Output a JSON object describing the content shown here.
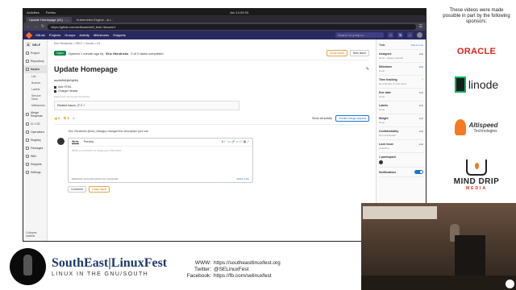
{
  "system_bar": {
    "activities": "Activities",
    "browser": "Firefox",
    "clock": "Jun 14  09:33"
  },
  "browser": {
    "tabs": [
      "Update Homepage (#1) · ...",
      "Kubernetes Engine - sl-i..."
    ],
    "url": "https://gitlab.com/selfsuse/self_test/-/issues/1"
  },
  "gitlab_header": {
    "logo": "GitLab",
    "menus": [
      "Projects",
      "Groups",
      "Activity",
      "Milestones",
      "Snippets"
    ],
    "search_placeholder": "Search or jump to..."
  },
  "left_sidebar": {
    "project_initial": "S",
    "project_name": "SELF",
    "items": [
      "Project",
      "Repository",
      "Issues",
      "Merge Requests",
      "CI / CD",
      "Operations",
      "Registry",
      "Packages",
      "Wiki",
      "Snippets",
      "Settings"
    ],
    "issue_subitems": [
      "List",
      "Boards",
      "Labels",
      "Service Desk",
      "Milestones"
    ],
    "collapse": "Collapse sidebar"
  },
  "issue": {
    "breadcrumb": "Eric Hendricks > SELF > Issues > #1",
    "status": "Open",
    "opened_by": "Opened 1 minute ago by",
    "author": "Eric Hendricks",
    "tasks_summary": "0 of 2 tasks completed",
    "close_button": "Close issue",
    "new_button": "New issue",
    "title": "Update Homepage",
    "description": "asdfdfhfhjkfhjkfhj",
    "tasks": [
      "Add HTML",
      "Change Header"
    ],
    "edited": "Edited just now by Eric Hendricks",
    "related_label": "Related issues",
    "related_count": "0",
    "thumbs_up": "0",
    "thumbs_down": "0",
    "show_all": "Show all activity",
    "merge_button": "Create merge request",
    "event_text": "Eric Hendricks @eric_thedguy changed the description just now",
    "write_tab": "Write",
    "preview_tab": "Preview",
    "comment_placeholder": "Write a comment or drag your files here…",
    "markdown_note": "Markdown and quick actions are supported",
    "attach": "Attach a file",
    "comment_button": "Comment",
    "close_issue_button": "Close issue"
  },
  "right_sidebar": {
    "todo": "Todo",
    "add_todo": "Add a to do",
    "fields": [
      {
        "label": "Assignee",
        "value": "None - assign yourself"
      },
      {
        "label": "Milestone",
        "value": "None"
      },
      {
        "label": "Time tracking",
        "value": "No estimate or time spent"
      },
      {
        "label": "Due date",
        "value": "None"
      },
      {
        "label": "Labels",
        "value": "None"
      },
      {
        "label": "Weight",
        "value": "None"
      },
      {
        "label": "Confidentiality",
        "value": "Not confidential"
      },
      {
        "label": "Lock issue",
        "value": "Unlocked"
      }
    ],
    "edit": "Edit",
    "participants": "1 participant",
    "notifications": "Notifications"
  },
  "sponsors": {
    "heading": "These videos were made possible in part by the following sponsors:",
    "oracle": "ORACLE",
    "linode": "linode",
    "altispeed_name": "Altispeed",
    "altispeed_sub": "Technologies",
    "minddrip_name": "MIND DRIP",
    "minddrip_sub": "MEDIA"
  },
  "footer": {
    "title": "SouthEast|LinuxFest",
    "subtitle": "LINUX IN THE GNU/SOUTH",
    "contacts": [
      {
        "key": "WWW:",
        "value": "https://southeastlinuxfest.org"
      },
      {
        "key": "Twitter:",
        "value": "@SELinuxFest"
      },
      {
        "key": "Facebook:",
        "value": "https://fb.com/selinuxfest"
      }
    ]
  },
  "colors": {
    "gitlab_header": "#292961",
    "open_badge": "#108548",
    "link_blue": "#1f75cb",
    "oracle_red": "#e2231a",
    "linode_green": "#02b159",
    "orange": "#f47920"
  }
}
